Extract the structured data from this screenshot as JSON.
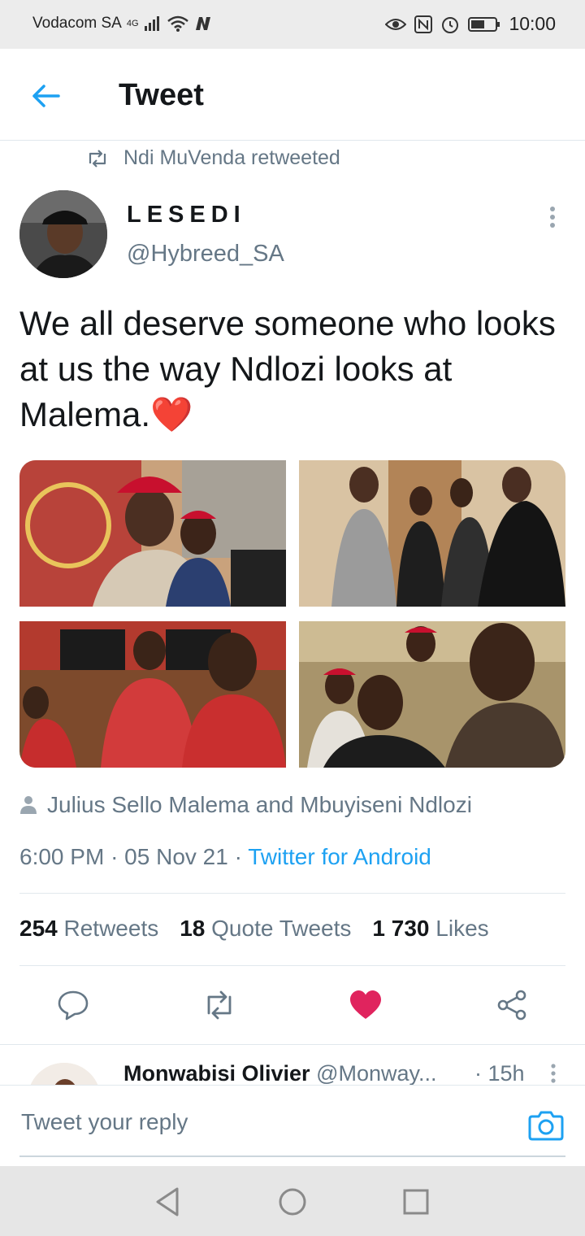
{
  "status_bar": {
    "carrier": "Vodacom SA",
    "network": "4G",
    "time": "10:00"
  },
  "header": {
    "title": "Tweet"
  },
  "retweet_context": {
    "text": "Ndi MuVenda retweeted"
  },
  "tweet": {
    "author_name": "LESEDI",
    "author_handle": "@Hybreed_SA",
    "text": "We all deserve someone who looks at us the way Ndlozi looks at Malema.❤️",
    "tagged_people": "Julius Sello Malema and Mbuyiseni Ndlozi",
    "time": "6:00 PM",
    "date": "05 Nov 21",
    "source": "Twitter for Android",
    "stats": {
      "retweets_count": "254",
      "retweets_label": "Retweets",
      "quotes_count": "18",
      "quotes_label": "Quote Tweets",
      "likes_count": "1 730",
      "likes_label": "Likes"
    },
    "liked": true
  },
  "reply_preview": {
    "name": "Monwabisi Olivier",
    "handle": "@Monway...",
    "time": "· 15h"
  },
  "compose": {
    "placeholder": "Tweet your reply"
  },
  "colors": {
    "accent": "#1da1f2",
    "like": "#e0245e",
    "secondary_text": "#657786"
  }
}
